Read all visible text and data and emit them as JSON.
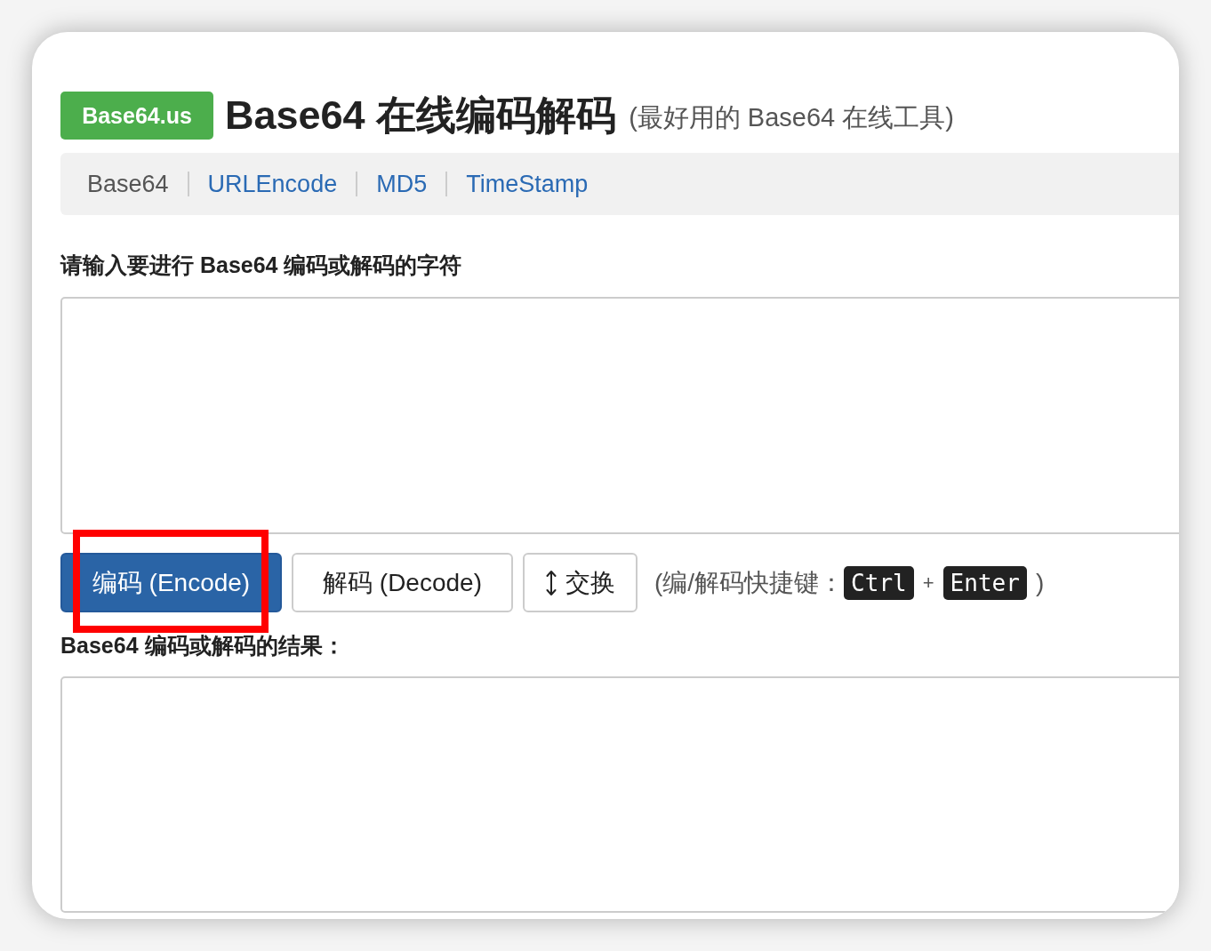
{
  "logo": {
    "text": "Base64.us"
  },
  "title": "Base64 在线编码解码",
  "subtitle": "(最好用的 Base64 在线工具)",
  "nav": [
    {
      "label": "Base64",
      "selected": true
    },
    {
      "label": "URLEncode",
      "selected": false
    },
    {
      "label": "MD5",
      "selected": false
    },
    {
      "label": "TimeStamp",
      "selected": false
    }
  ],
  "input": {
    "label": "请输入要进行 Base64 编码或解码的字符"
  },
  "buttons": [
    {
      "label": "编码 (Encode)",
      "kind": "primary",
      "highlighted": true
    },
    {
      "label": "解码 (Decode)",
      "kind": "default",
      "highlighted": false
    },
    {
      "label": "交换",
      "kind": "swap",
      "highlighted": false
    }
  ],
  "shortcut": {
    "prefix": "(编/解码快捷键：",
    "keys": [
      "Ctrl",
      "Enter"
    ],
    "joiner": "+",
    "suffix": ")"
  },
  "output": {
    "label": "Base64 编码或解码的结果："
  }
}
